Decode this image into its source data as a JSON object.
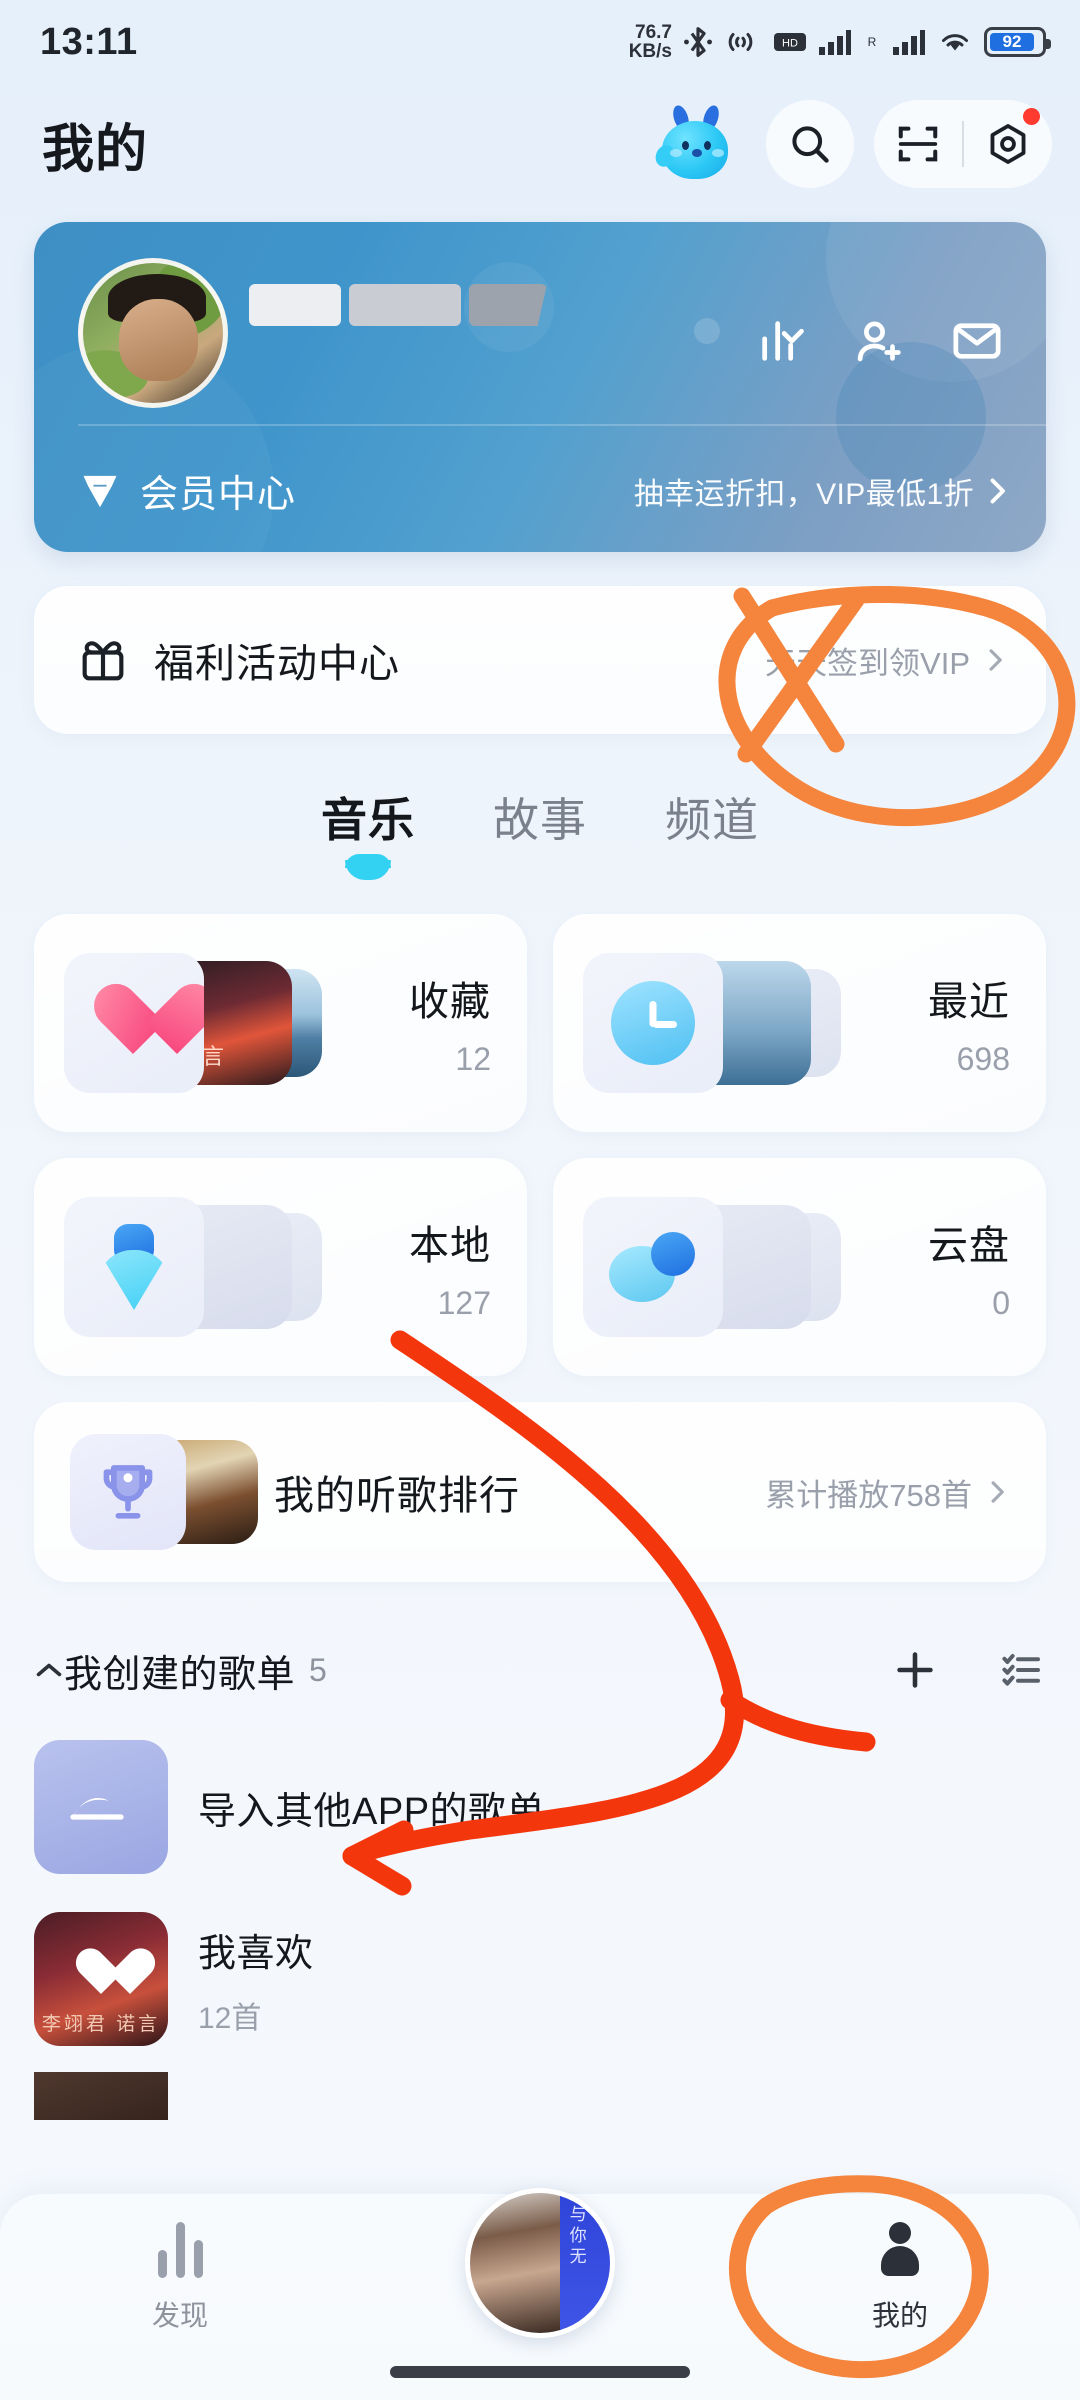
{
  "status_bar": {
    "time": "13:11",
    "net_speed_value": "76.7",
    "net_speed_unit": "KB/s",
    "battery_percent": "92",
    "icons": [
      "bluetooth-icon",
      "nfc-icon",
      "hd-icon",
      "signal-1-icon",
      "roaming-icon",
      "signal-2-icon",
      "wifi-icon",
      "battery-icon"
    ]
  },
  "header": {
    "title": "我的",
    "mascot": "mascot-icon",
    "search": "search-icon",
    "scan": "scan-icon",
    "settings": "settings-icon"
  },
  "vip_banner": {
    "member_center_label": "会员中心",
    "promo_text": "抽幸运折扣，VIP最低1折",
    "chevron": "›",
    "actions": [
      "chart-icon",
      "add-friend-icon",
      "mail-icon"
    ],
    "avatar": "user-avatar",
    "nickname": "",
    "vip_badge": "vip-heart-icon"
  },
  "welfare": {
    "title": "福利活动中心",
    "subtitle": "天天签到领VIP",
    "icon": "gift-icon",
    "chevron": "›"
  },
  "tabs": [
    {
      "label": "音乐",
      "active": true
    },
    {
      "label": "故事",
      "active": false
    },
    {
      "label": "频道",
      "active": false
    }
  ],
  "cards": [
    {
      "title": "收藏",
      "count": "12",
      "icon": "heart-icon"
    },
    {
      "title": "最近",
      "count": "698",
      "icon": "clock-icon"
    },
    {
      "title": "本地",
      "count": "127",
      "icon": "download-icon"
    },
    {
      "title": "云盘",
      "count": "0",
      "icon": "cloud-icon"
    }
  ],
  "ranking": {
    "title": "我的听歌排行",
    "subtitle": "累计播放758首",
    "icon": "trophy-icon",
    "chevron": "›"
  },
  "playlist_section": {
    "caret": "⌃",
    "title": "我创建的歌单",
    "count": "5",
    "add_label": "+",
    "manage_icon": "list-manage-icon"
  },
  "playlists": [
    {
      "name": "导入其他APP的歌单",
      "sub": "",
      "cover": "import-icon"
    },
    {
      "name": "我喜欢",
      "sub": "12首",
      "cover": "liked-cover",
      "cover_text": "李翊君 诺言"
    }
  ],
  "bottom_nav": [
    {
      "label": "发现",
      "icon": "discover-bars-icon",
      "active": false
    },
    {
      "label": "",
      "icon": "mini-player-avatar",
      "active": false
    },
    {
      "label": "我的",
      "icon": "person-icon",
      "active": true
    }
  ],
  "annotations": {
    "color_orange": "#f5843c",
    "color_red": "#f4360d",
    "marks": [
      "circle-on-welfare-row",
      "arrow-to-import-playlist",
      "circle-on-mine-tab"
    ]
  }
}
